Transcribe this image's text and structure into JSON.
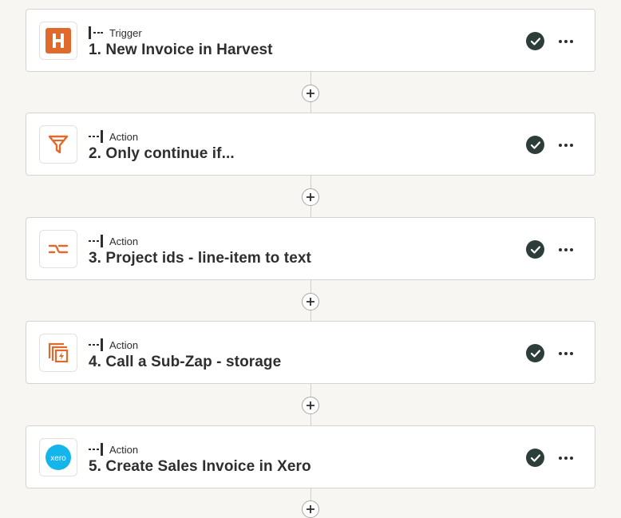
{
  "colors": {
    "accent": "#e06a2b",
    "check_bg": "#2d3e3a",
    "xero_blue": "#13b5ea",
    "text": "#2d2e2e",
    "background": "#f7f6f3"
  },
  "steps": [
    {
      "kind": "Trigger",
      "title": "1. New Invoice in Harvest",
      "icon": "harvest-icon",
      "status": "complete"
    },
    {
      "kind": "Action",
      "title": "2. Only continue if...",
      "icon": "filter-icon",
      "status": "complete"
    },
    {
      "kind": "Action",
      "title": "3. Project ids - line-item to text",
      "icon": "formatter-icon",
      "status": "complete"
    },
    {
      "kind": "Action",
      "title": "4. Call a Sub-Zap - storage",
      "icon": "sub-zap-icon",
      "status": "complete"
    },
    {
      "kind": "Action",
      "title": "5. Create Sales Invoice in Xero",
      "icon": "xero-icon",
      "status": "complete",
      "icon_text": "xero"
    }
  ]
}
